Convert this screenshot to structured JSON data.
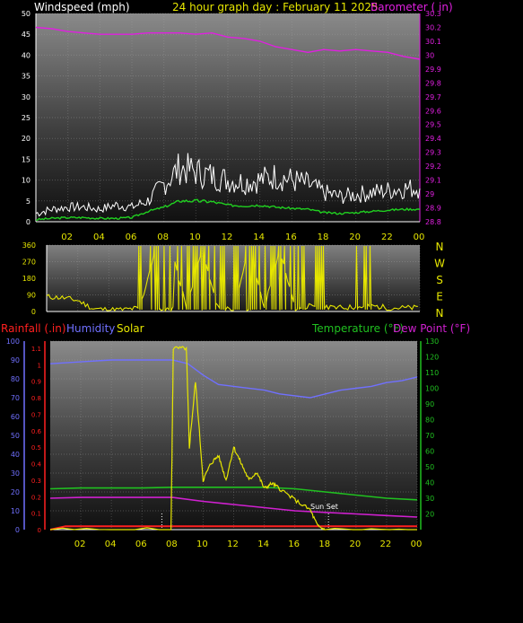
{
  "header": {
    "windspeed_label": "Windspeed (mph)",
    "title": "24 hour graph day : February 11 2025",
    "barometer_label": "Barometer ( in)"
  },
  "colors": {
    "background": "#000000",
    "panel_top": "#8a8a8a",
    "panel_bottom": "#1a1a1a",
    "barometer": "#e020e0",
    "wind_avg": "#20d020",
    "wind_gust": "#ffffff",
    "direction": "#e6e600",
    "rain": "#ff2020",
    "humidity": "#7070ff",
    "solar": "#e6e600",
    "temperature": "#20c020",
    "dewpoint": "#d020d0",
    "x_ticks": "#e6e600"
  },
  "chart_data": [
    {
      "type": "line",
      "name": "wind-barometer",
      "title": "24 hour graph day : February 11 2025",
      "x_tick_labels": [
        "02",
        "04",
        "06",
        "08",
        "10",
        "12",
        "14",
        "16",
        "18",
        "20",
        "22",
        "00"
      ],
      "xlim": [
        0,
        24
      ],
      "y_left": {
        "label": "Windspeed (mph)",
        "ylim": [
          0,
          50
        ],
        "ticks": [
          0,
          5,
          10,
          15,
          20,
          25,
          30,
          35,
          40,
          45,
          50
        ]
      },
      "y_right": {
        "label": "Barometer ( in)",
        "ylim": [
          28.8,
          30.3
        ],
        "ticks": [
          "28.8",
          "28.9",
          "29",
          "29.1",
          "29.2",
          "29.3",
          "29.4",
          "29.5",
          "29.6",
          "29.7",
          "29.8",
          "29.9",
          "30",
          "30.1",
          "30.2",
          "30.3"
        ]
      },
      "series": [
        {
          "name": "Barometer",
          "axis": "right",
          "x": [
            0,
            1,
            2,
            3,
            4,
            5,
            6,
            7,
            8,
            9,
            10,
            11,
            12,
            13,
            14,
            15,
            16,
            17,
            18,
            19,
            20,
            21,
            22,
            23,
            24
          ],
          "values": [
            30.2,
            30.19,
            30.17,
            30.16,
            30.15,
            30.15,
            30.15,
            30.16,
            30.16,
            30.16,
            30.15,
            30.16,
            30.13,
            30.12,
            30.1,
            30.06,
            30.04,
            30.02,
            30.04,
            30.03,
            30.04,
            30.03,
            30.02,
            29.99,
            29.97
          ]
        },
        {
          "name": "Wind Avg",
          "axis": "left",
          "x": [
            0,
            1,
            2,
            3,
            4,
            5,
            6,
            7,
            8,
            9,
            10,
            11,
            12,
            13,
            14,
            15,
            16,
            17,
            18,
            19,
            20,
            21,
            22,
            23,
            24
          ],
          "values": [
            0.5,
            0.8,
            1,
            1,
            0.8,
            0.8,
            1,
            2.5,
            3.5,
            5,
            5,
            4.8,
            4,
            3.8,
            4,
            3.5,
            3.2,
            3,
            2.2,
            2,
            2.2,
            2.5,
            2.8,
            3,
            3
          ]
        },
        {
          "name": "Wind Gust",
          "axis": "left",
          "x": [
            0,
            1,
            2,
            3,
            4,
            5,
            6,
            7,
            8,
            9,
            10,
            11,
            12,
            13,
            14,
            15,
            16,
            17,
            18,
            19,
            20,
            21,
            22,
            23,
            24
          ],
          "values": [
            2,
            3,
            3.5,
            3.5,
            3,
            4,
            3.5,
            5,
            9,
            13,
            12,
            11,
            10,
            9.5,
            10,
            11,
            10,
            9,
            7,
            6,
            6.5,
            7,
            7.5,
            8,
            8
          ]
        }
      ]
    },
    {
      "type": "line",
      "name": "wind-direction",
      "x_tick_labels": [],
      "xlim": [
        0,
        24
      ],
      "y_left": {
        "ylim": [
          0,
          360
        ],
        "ticks": [
          0,
          90,
          180,
          270,
          360
        ]
      },
      "compass_labels": [
        "N",
        "W",
        "S",
        "E",
        "N"
      ],
      "series": [
        {
          "name": "Direction",
          "x": [
            0,
            1,
            2,
            3,
            4,
            5,
            6,
            7,
            8,
            9,
            10,
            11,
            12,
            13,
            14,
            15,
            16,
            17,
            18,
            19,
            20,
            21,
            22,
            23,
            24
          ],
          "values": [
            80,
            75,
            60,
            15,
            10,
            10,
            20,
            340,
            350,
            10,
            340,
            20,
            5,
            350,
            20,
            340,
            10,
            30,
            20,
            20,
            25,
            30,
            20,
            20,
            20
          ]
        }
      ]
    },
    {
      "type": "line",
      "name": "rain-humidity-solar-temp",
      "x_tick_labels": [
        "02",
        "04",
        "06",
        "08",
        "10",
        "12",
        "14",
        "16",
        "18",
        "20",
        "22",
        "00"
      ],
      "xlim": [
        0,
        24
      ],
      "legend_left": [
        {
          "text": "Rainfall (.in)"
        },
        {
          "text": "Humidity"
        },
        {
          "text": "Solar"
        }
      ],
      "legend_right": [
        {
          "text": "Temperature (°F)"
        },
        {
          "text": "Dew Point (°F)"
        }
      ],
      "y_humidity": {
        "ylim": [
          0,
          100
        ],
        "ticks": [
          0,
          10,
          20,
          30,
          40,
          50,
          60,
          70,
          80,
          90,
          100
        ]
      },
      "y_rain": {
        "ylim": [
          0,
          1.1
        ],
        "ticks": [
          "0",
          "0.1",
          "0.2",
          "0.3",
          "0.4",
          "0.5",
          "0.6",
          "0.7",
          "0.8",
          "0.9",
          "1",
          "1.1"
        ]
      },
      "y_temp": {
        "ylim": [
          10,
          130
        ],
        "ticks": [
          20,
          30,
          40,
          50,
          60,
          70,
          80,
          90,
          100,
          110,
          120,
          130
        ]
      },
      "annotation": "Sun Set",
      "series": [
        {
          "name": "Humidity",
          "x": [
            0,
            2,
            4,
            6,
            8,
            9,
            10,
            11,
            12,
            14,
            15,
            16,
            17,
            18,
            19,
            20,
            21,
            22,
            23,
            24
          ],
          "values": [
            88,
            89,
            90,
            90,
            90,
            88,
            82,
            77,
            76,
            74,
            72,
            71,
            70,
            72,
            74,
            75,
            76,
            78,
            79,
            81
          ]
        },
        {
          "name": "Rainfall",
          "x": [
            0,
            1,
            24
          ],
          "values": [
            0,
            0.02,
            0.02
          ]
        },
        {
          "name": "Solar",
          "x": [
            0,
            7.9,
            8.05,
            8.9,
            9.1,
            9.5,
            10,
            10.5,
            11,
            11.5,
            12,
            12.5,
            13,
            13.5,
            14,
            14.5,
            15,
            16,
            17,
            17.5,
            18,
            24
          ],
          "values": [
            0,
            0,
            1.1,
            1.1,
            0.5,
            0.9,
            0.3,
            0.4,
            0.45,
            0.3,
            0.5,
            0.4,
            0.3,
            0.35,
            0.25,
            0.28,
            0.25,
            0.18,
            0.12,
            0.02,
            0,
            0
          ]
        },
        {
          "name": "Temperature",
          "x": [
            0,
            2,
            4,
            6,
            8,
            10,
            12,
            14,
            16,
            18,
            20,
            22,
            24
          ],
          "values": [
            36,
            36.5,
            36.5,
            36.5,
            37,
            37,
            37,
            37,
            36,
            34,
            32,
            30,
            29
          ]
        },
        {
          "name": "Dew Point",
          "x": [
            0,
            2,
            4,
            6,
            8,
            10,
            12,
            14,
            16,
            18,
            20,
            22,
            24
          ],
          "values": [
            30,
            30.5,
            30.5,
            30.5,
            30.5,
            28,
            26,
            24,
            22,
            21,
            20,
            19,
            18
          ]
        }
      ]
    }
  ]
}
